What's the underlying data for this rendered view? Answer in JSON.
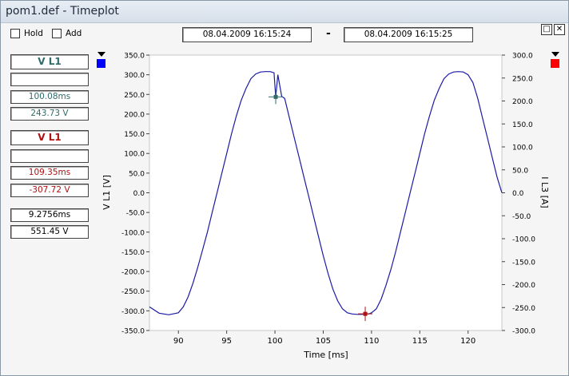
{
  "window": {
    "title": "pom1.def - Timeplot"
  },
  "toolbar": {
    "hold_label": "Hold",
    "add_label": "Add",
    "date_start": "08.04.2009    16:15:24",
    "date_end": "08.04.2009    16:15:25",
    "separator": "-"
  },
  "cursor1": {
    "title": "V L1",
    "name_value": "",
    "time": "100.08ms",
    "value": "243.73 V",
    "color": "#0000ff"
  },
  "cursor2": {
    "title": "V L1",
    "name_value": "",
    "time": "109.35ms",
    "value": "-307.72 V",
    "color": "#ff0000"
  },
  "diff": {
    "time": "9.2756ms",
    "value": "551.45 V"
  },
  "chart_data": {
    "type": "line",
    "xlabel": "Time [ms]",
    "ylabel_left": "V L1 [V]",
    "ylabel_right": "I L3 [A]",
    "xlim": [
      87,
      123.5
    ],
    "ylim_left": [
      -350,
      350
    ],
    "ylim_right": [
      -300,
      300
    ],
    "x_ticks": [
      "90",
      "95",
      "100",
      "105",
      "110",
      "115",
      "120"
    ],
    "y_ticks_left": [
      "350.0",
      "300.0",
      "250.0",
      "200.0",
      "150.0",
      "100.0",
      "50.0",
      "0.0",
      "-50.0",
      "-100.0",
      "-150.0",
      "-200.0",
      "-250.0",
      "-300.0",
      "-350.0"
    ],
    "y_ticks_right": [
      "300.0",
      "250.0",
      "200.0",
      "150.0",
      "100.0",
      "50.0",
      "0.0",
      "-50.0",
      "-100.0",
      "-150.0",
      "-200.0",
      "-250.0",
      "-300.0"
    ],
    "series": [
      {
        "color": "#1a1aa6",
        "x": [
          87,
          88,
          89,
          90,
          90.5,
          91,
          91.5,
          92,
          92.5,
          93,
          93.5,
          94,
          94.5,
          95,
          95.5,
          96,
          96.5,
          97,
          97.5,
          98,
          98.5,
          99,
          99.5,
          99.9,
          100.08,
          100.3,
          100.7,
          101,
          101.5,
          102,
          102.5,
          103,
          103.5,
          104,
          104.5,
          105,
          105.5,
          106,
          106.5,
          107,
          107.5,
          108,
          108.5,
          109,
          109.35,
          109.7,
          110,
          110.5,
          111,
          111.5,
          112,
          112.5,
          113,
          113.5,
          114,
          114.5,
          115,
          115.5,
          116,
          116.5,
          117,
          117.5,
          118,
          118.5,
          119,
          119.5,
          120,
          120.5,
          121,
          121.5,
          122,
          122.5,
          123,
          123.5
        ],
        "y": [
          -290,
          -306,
          -310,
          -305,
          -290,
          -265,
          -230,
          -190,
          -145,
          -100,
          -50,
          0,
          50,
          100,
          150,
          195,
          235,
          265,
          290,
          302,
          307,
          308,
          308,
          305,
          243,
          300,
          245,
          240,
          190,
          140,
          90,
          40,
          -10,
          -60,
          -110,
          -160,
          -205,
          -245,
          -275,
          -295,
          -305,
          -308,
          -309,
          -309,
          -308,
          -308,
          -305,
          -295,
          -270,
          -235,
          -195,
          -150,
          -100,
          -50,
          0,
          50,
          100,
          150,
          195,
          235,
          265,
          290,
          302,
          307,
          308,
          307,
          300,
          280,
          240,
          190,
          140,
          90,
          40,
          0
        ]
      }
    ],
    "cursors": [
      {
        "x": 100.08,
        "y": 243.73,
        "color": "#2f6b6b"
      },
      {
        "x": 109.35,
        "y": -307.72,
        "color": "#b01010"
      }
    ]
  }
}
